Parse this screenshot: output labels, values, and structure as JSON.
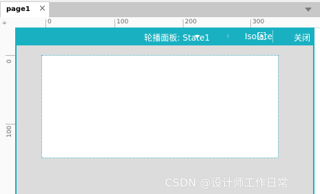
{
  "tabs": [
    {
      "label": "page1",
      "active": true
    }
  ],
  "ruler": {
    "top_labels": [
      "0",
      "100",
      "200",
      "300"
    ],
    "left_labels": [
      "0",
      "100"
    ]
  },
  "panel": {
    "state_label": "轮播面板: State1",
    "isolate_label": "Isolate",
    "close_label": "关闭",
    "accent_color": "#19b1c2"
  },
  "watermark": "CSDN @设计师工作日常"
}
